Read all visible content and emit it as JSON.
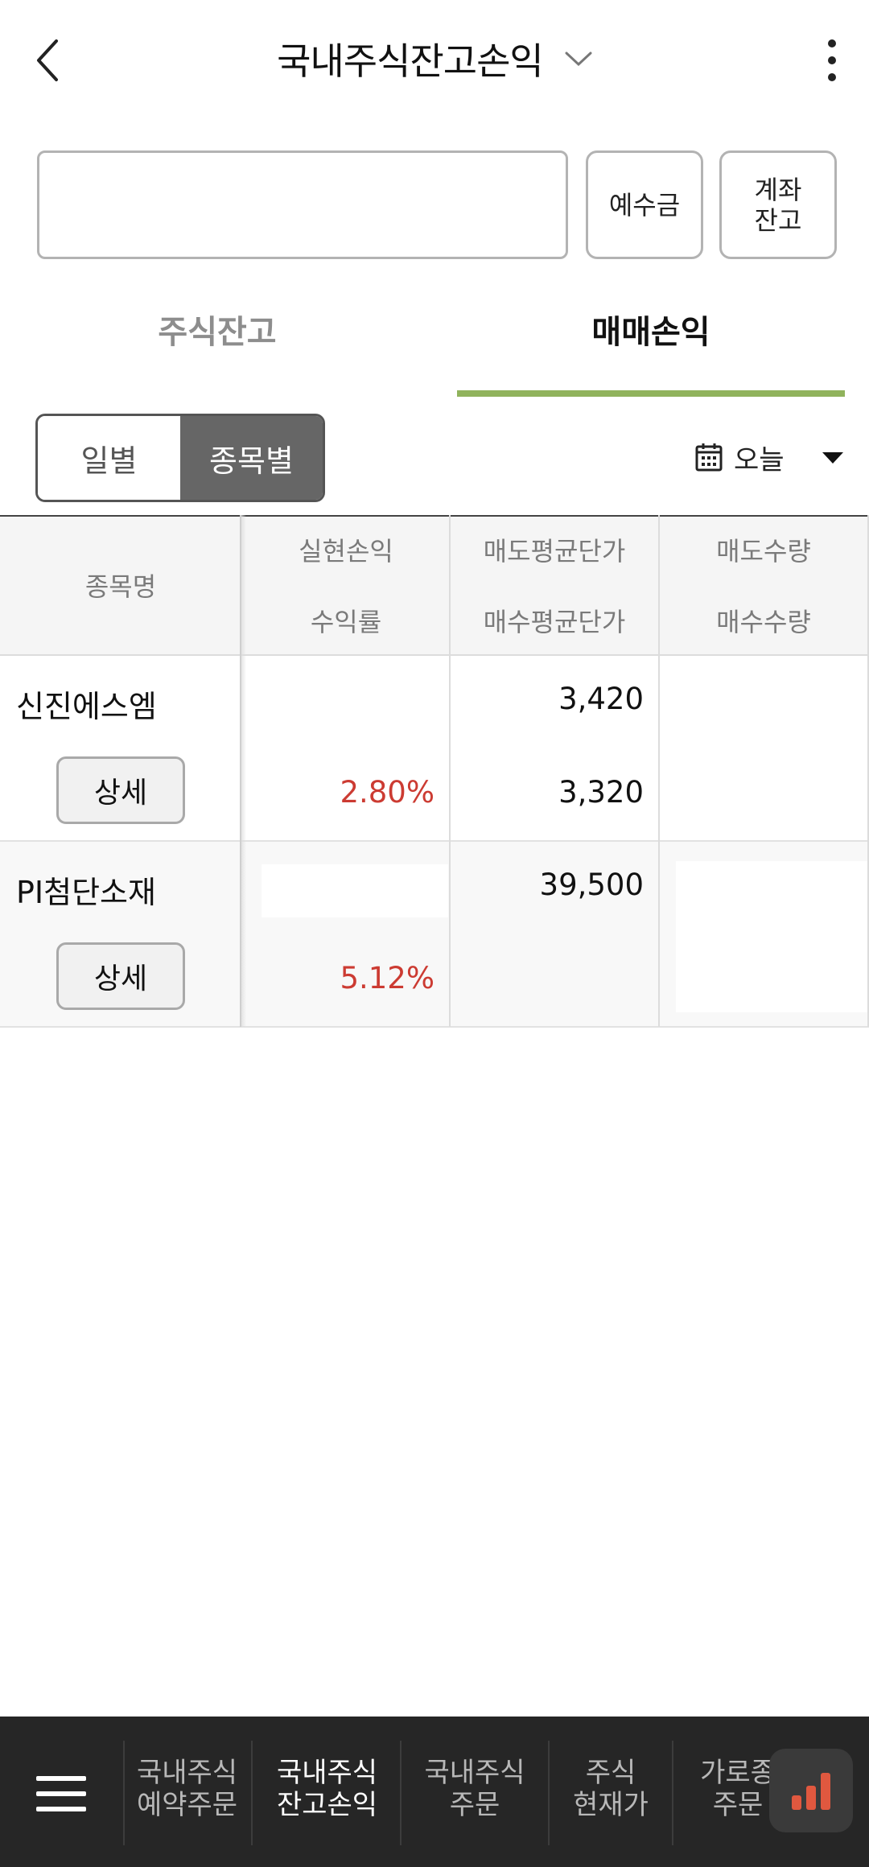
{
  "header": {
    "title": "국내주식잔고손익"
  },
  "account": {
    "input_value": "",
    "deposit_button": "예수금",
    "balance_button": "계좌\n잔고"
  },
  "tabs": [
    {
      "label": "주식잔고",
      "active": false
    },
    {
      "label": "매매손익",
      "active": true
    }
  ],
  "segment": {
    "daily": "일별",
    "by_stock": "종목별",
    "selected": "종목별"
  },
  "date_filter": {
    "label": "오늘"
  },
  "table": {
    "headers": {
      "name": "종목명",
      "realized_pl": "실현손익",
      "return_rate": "수익률",
      "avg_sell": "매도평균단가",
      "avg_buy": "매수평균단가",
      "sell_qty": "매도수량",
      "buy_qty": "매수수량"
    },
    "rows": [
      {
        "name": "신진에스엠",
        "detail": "상세",
        "realized_pl": "",
        "return_rate": "2.80%",
        "avg_sell": "3,420",
        "avg_buy": "3,320",
        "sell_qty": "",
        "buy_qty": ""
      },
      {
        "name": "PI첨단소재",
        "detail": "상세",
        "realized_pl": "",
        "return_rate": "5.12%",
        "avg_sell": "39,500",
        "avg_buy": "",
        "sell_qty": "",
        "buy_qty": ""
      }
    ]
  },
  "bottom_nav": {
    "items": [
      {
        "label": "국내주식\n예약주문",
        "active": false
      },
      {
        "label": "국내주식\n잔고손익",
        "active": true
      },
      {
        "label": "국내주식\n주문",
        "active": false
      },
      {
        "label": "주식\n현재가",
        "active": false
      },
      {
        "label": "가로종\n주문",
        "active": false
      }
    ]
  },
  "colors": {
    "accent": "#90b35c",
    "positive": "#cc3b32",
    "nav_bg": "#262626",
    "fab_icon": "#e0583f"
  }
}
